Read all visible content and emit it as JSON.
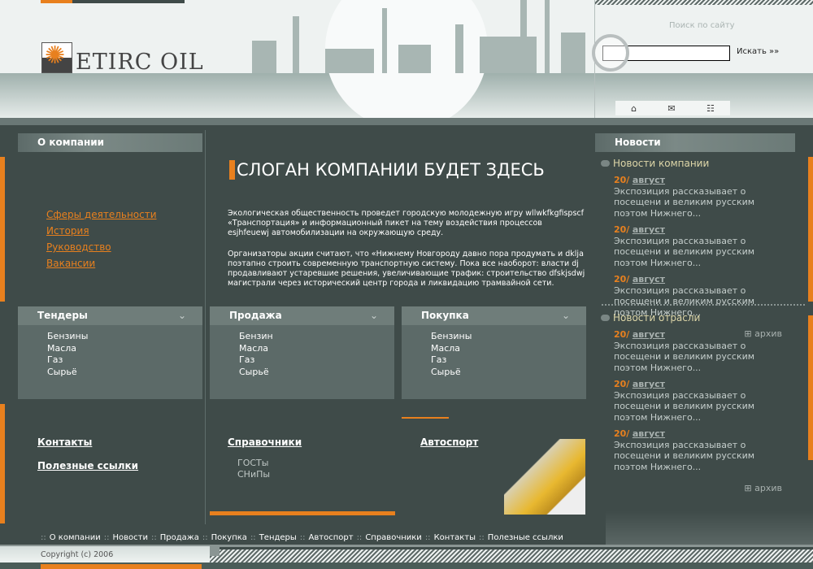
{
  "brand": {
    "name": "ETIRC OIL"
  },
  "search": {
    "label": "Поиск по сайту",
    "placeholder": "",
    "button": "Искать »»"
  },
  "icons": {
    "home": "home-icon",
    "mail": "mail-icon",
    "sitemap": "sitemap-icon"
  },
  "about": {
    "title": "О компании",
    "links": [
      "Сферы деятельности",
      "История",
      "Руководство",
      "Вакансии"
    ]
  },
  "main": {
    "slogan": "СЛОГАН КОМПАНИИ БУДЕТ ЗДЕСЬ",
    "paragraphs": [
      "Экологическая общественность проведет городскую молодежную игру wllwkfkgfispscf «Транспортация» и информационный пикет на тему воздействия процессов esjhfeuewj автомобилизации на окружающую среду.",
      "Организаторы акции считают, что «Нижнему Новгороду давно пора продумать и dklja поэтапно строить современную транспортную систему. Пока все наоборот: власти dj продавливают устаревшие решения, увеличивающие трафик: строительство dfskjsdwj магистрали через исторический центр города и ликвидацию трамвайной сети."
    ]
  },
  "boxes": [
    {
      "title": "Тендеры",
      "items": [
        "Бензины",
        "Масла",
        "Газ",
        "Сырьё"
      ]
    },
    {
      "title": "Продажа",
      "items": [
        "Бензин",
        "Масла",
        "Газ",
        "Сырьё"
      ]
    },
    {
      "title": "Покупка",
      "items": [
        "Бензины",
        "Масла",
        "Газ",
        "Сырьё"
      ]
    }
  ],
  "bottom": {
    "contacts": "Контакты",
    "useful": "Полезные ссылки",
    "refs": "Справочники",
    "refs_items": [
      "ГОСТы",
      "СНиПы"
    ],
    "autosport": "Автоспорт"
  },
  "news": {
    "title": "Новости",
    "sections": [
      {
        "title": "Новости компании",
        "archive": "архив",
        "items": [
          {
            "day": "20/",
            "month": "август",
            "text": "Экспозиция рассказывает о посещени и великим русским поэтом Нижнего..."
          },
          {
            "day": "20/",
            "month": "август",
            "text": "Экспозиция рассказывает о посещени и великим русским поэтом Нижнего..."
          },
          {
            "day": "20/",
            "month": "август",
            "text": "Экспозиция рассказывает о посещени и великим русским поэтом Нижнего..."
          }
        ]
      },
      {
        "title": "Новости отрасли",
        "archive": "архив",
        "items": [
          {
            "day": "20/",
            "month": "август",
            "text": "Экспозиция рассказывает о посещени и великим русским поэтом Нижнего..."
          },
          {
            "day": "20/",
            "month": "август",
            "text": "Экспозиция рассказывает о посещени и великим русским поэтом Нижнего..."
          },
          {
            "day": "20/",
            "month": "август",
            "text": "Экспозиция рассказывает о посещени и великим русским поэтом Нижнего..."
          }
        ]
      }
    ]
  },
  "footer": {
    "nav": [
      "О компании",
      "Новости",
      "Продажа",
      "Покупка",
      "Тендеры",
      "Автоспорт",
      "Справочники",
      "Контакты",
      "Полезные ссылки"
    ],
    "copyright": "Copyright (c)  2006"
  },
  "colors": {
    "accent": "#e8801e",
    "background": "#3f4b49",
    "header": "#eef2f1"
  }
}
